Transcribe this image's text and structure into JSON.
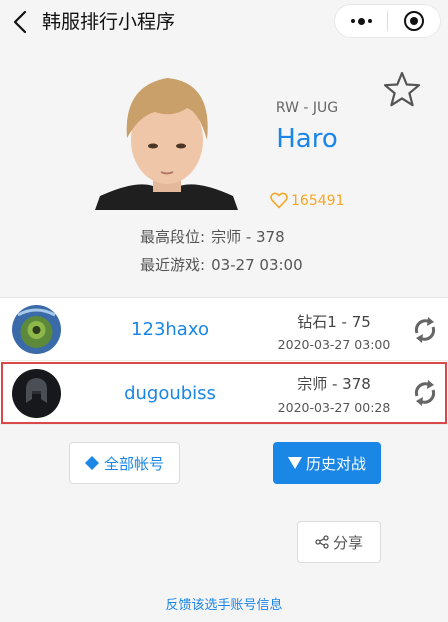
{
  "nav": {
    "title": "韩服排行小程序"
  },
  "player": {
    "role": "RW - JUG",
    "name": "Haro",
    "likes": "165491",
    "highest_rank_label": "最高段位:",
    "highest_rank_value": "宗师 - 378",
    "recent_game_label": "最近游戏:",
    "recent_game_value": "03-27 03:00"
  },
  "accounts": [
    {
      "name": "123haxo",
      "rank": "钻石1 - 75",
      "time": "2020-03-27 03:00"
    },
    {
      "name": "dugoubiss",
      "rank": "宗师 - 378",
      "time": "2020-03-27 00:28"
    }
  ],
  "buttons": {
    "all_accounts": "全部帐号",
    "history": "历史对战",
    "share": "分享"
  },
  "feedback": "反馈该选手账号信息",
  "colors": {
    "accent": "#1a86e6",
    "likes": "#f5a623",
    "selected_border": "#d9494a"
  }
}
